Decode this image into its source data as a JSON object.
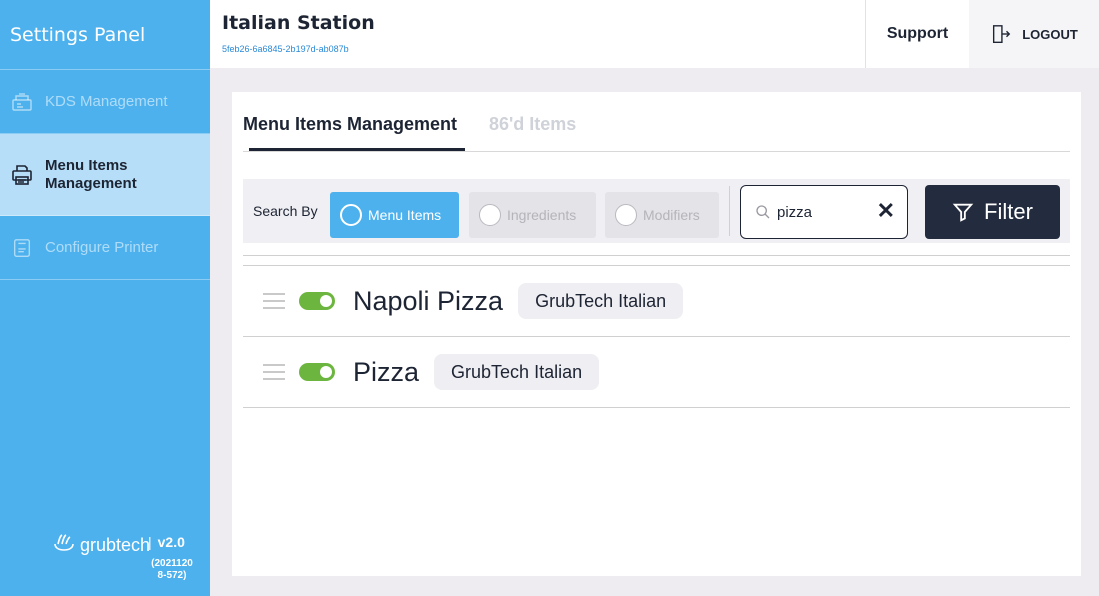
{
  "sidebar": {
    "title": "Settings Panel",
    "items": [
      {
        "label": "KDS Management",
        "icon": "kds-station-icon",
        "active": false
      },
      {
        "label": "Menu Items Management",
        "icon": "printer-menu-icon",
        "active": true
      },
      {
        "label": "Configure Printer",
        "icon": "printer-config-icon",
        "active": false
      }
    ],
    "footer": {
      "brand": "grubtech",
      "version_separator": "|",
      "version": "v2.0",
      "build": "(2021120 8-572)"
    }
  },
  "header": {
    "station_name": "Italian Station",
    "station_id": "5feb26-6a6845-2b197d-ab087b",
    "support_label": "Support",
    "logout_label": "LOGOUT"
  },
  "tabs": [
    {
      "label": "Menu Items Management",
      "active": true
    },
    {
      "label": "86'd Items",
      "active": false
    }
  ],
  "search": {
    "search_by_label": "Search By",
    "options": [
      {
        "label": "Menu Items",
        "selected": true
      },
      {
        "label": "Ingredients",
        "selected": false
      },
      {
        "label": "Modifiers",
        "selected": false
      }
    ],
    "query": "pizza",
    "clear_glyph": "✕",
    "filter_label": "Filter"
  },
  "items": [
    {
      "name": "Napoli Pizza",
      "enabled": true,
      "brand": "GrubTech Italian"
    },
    {
      "name": "Pizza",
      "enabled": true,
      "brand": "GrubTech Italian"
    }
  ],
  "colors": {
    "sidebar_bg": "#4db1ee",
    "sidebar_active_bg": "#b6def8",
    "primary_dark": "#232b3e",
    "toggle_on": "#6cb63f",
    "accent_blue": "#4db1ee"
  }
}
